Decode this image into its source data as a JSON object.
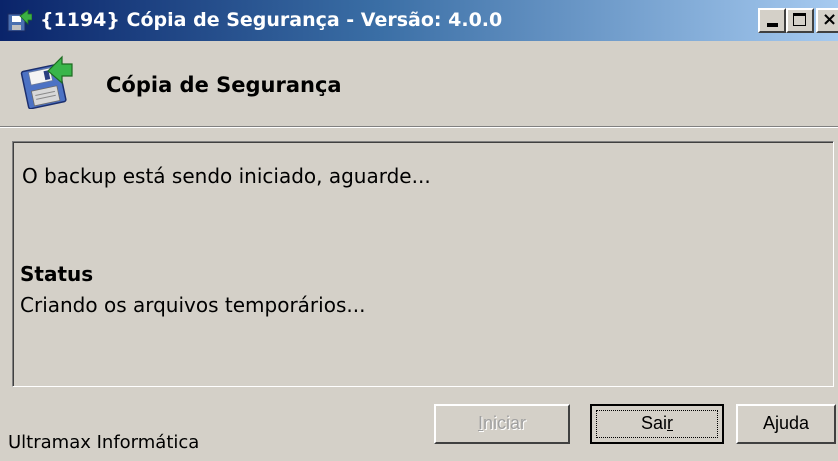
{
  "window": {
    "title": "{1194} Cópia de Segurança - Versão: 4.0.0",
    "controls": [
      "minimize",
      "maximize",
      "close"
    ]
  },
  "header": {
    "title": "Cópia de Segurança",
    "icon": "floppy-disk-arrow-icon"
  },
  "panel": {
    "message": "O backup está sendo iniciado, aguarde...",
    "status_label": "Status",
    "status_text": "Criando os arquivos temporários..."
  },
  "buttons": {
    "iniciar": {
      "prefix": "",
      "accel": "I",
      "rest": "niciar",
      "enabled": false
    },
    "sair": {
      "prefix": "Sai",
      "accel": "r",
      "rest": "",
      "default": true
    },
    "ajuda": {
      "label": "Ajuda"
    }
  },
  "footer": {
    "company": "Ultramax Informática"
  },
  "colors": {
    "titlebar_start": "#0a246a",
    "titlebar_end": "#a6caf0",
    "window_bg": "#d4d0c8",
    "disabled_text": "#a0a0a0"
  }
}
